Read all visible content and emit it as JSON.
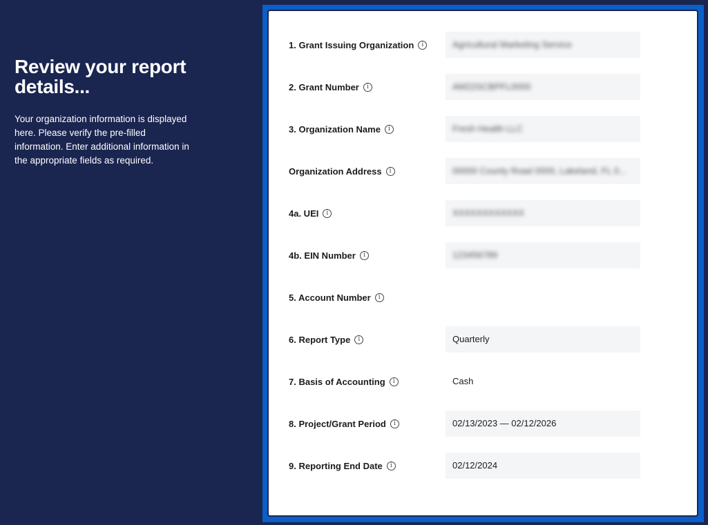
{
  "intro": {
    "title": "Review your report details...",
    "description": "Your organization information is displayed here. Please verify the pre-filled information. Enter additional information in the appropriate fields as required."
  },
  "fields": [
    {
      "label": "1. Grant Issuing Organization",
      "value": "Agricultural Marketing Service",
      "filled": true,
      "blurred": true
    },
    {
      "label": "2. Grant Number",
      "value": "AM22SCBPFL0000",
      "filled": true,
      "blurred": true
    },
    {
      "label": "3. Organization Name",
      "value": "Fresh Health LLC",
      "filled": true,
      "blurred": true
    },
    {
      "label": "Organization Address",
      "value": "00000 County Road 0000, Lakeland, FL 0...",
      "filled": true,
      "blurred": true
    },
    {
      "label": "4a. UEI",
      "value": "XXXXXXXXXXXX",
      "filled": true,
      "blurred": true
    },
    {
      "label": "4b. EIN Number",
      "value": "123456789",
      "filled": true,
      "blurred": true
    },
    {
      "label": "5. Account Number",
      "value": "",
      "filled": false,
      "blurred": false
    },
    {
      "label": "6. Report Type",
      "value": "Quarterly",
      "filled": true,
      "blurred": false
    },
    {
      "label": "7. Basis of Accounting",
      "value": "Cash",
      "filled": false,
      "blurred": false
    },
    {
      "label": "8. Project/Grant Period",
      "value": "02/13/2023 — 02/12/2026",
      "filled": true,
      "blurred": false
    },
    {
      "label": "9. Reporting End Date",
      "value": "02/12/2024",
      "filled": true,
      "blurred": false
    }
  ],
  "colors": {
    "sidebar": "#1a2550",
    "frame": "#0a5fc9",
    "field_background": "#f4f5f7"
  },
  "icons": {
    "field_info": "info-icon"
  }
}
